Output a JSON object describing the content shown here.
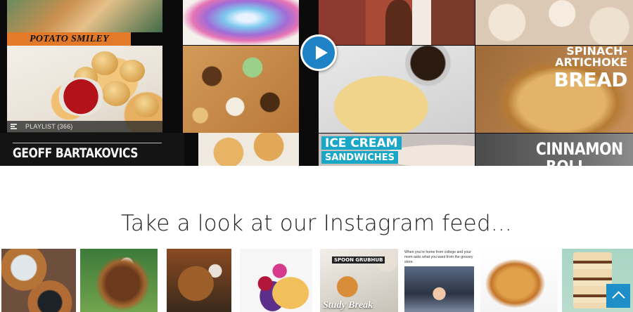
{
  "video": {
    "tiles": {
      "potato_label": "POTATO SMILEY",
      "spinach_line1": "SPINACH-",
      "spinach_line2": "ARTICHOKE",
      "spinach_line3": "BREAD",
      "ice_cream_line1": "ICE CREAM",
      "ice_cream_line2": "SANDWICHES",
      "cinnamon_line1": "CINNAMON",
      "cinnamon_line2": "ROLL",
      "creator_name": "GEOFF BARTAKOVICS"
    },
    "playlist_label": "PLAYLIST (366)",
    "play_icon": "play-icon"
  },
  "instagram": {
    "heading": "Take a look at our Instagram feed...",
    "posts": [
      {
        "alt": "drinks-post"
      },
      {
        "alt": "ice-cream-cone-post"
      },
      {
        "alt": "chewbacca-treat-post"
      },
      {
        "alt": "rainbow-cannoli-post"
      },
      {
        "alt": "study-break-post",
        "logo_text": "SPOON  GRUBHUB",
        "title": "Study Break"
      },
      {
        "alt": "grocery-meme-post",
        "caption": "When you're home from college and your mom asks what you want from the grocery store."
      },
      {
        "alt": "pasta-post"
      },
      {
        "alt": "ice-cream-sandwich-post"
      }
    ]
  },
  "controls": {
    "back_to_top_icon": "chevron-up-icon"
  },
  "colors": {
    "accent": "#1e82c6",
    "potato_label_bg": "#e27a2a",
    "ice_cream_label_bg": "#1aa6c6"
  }
}
